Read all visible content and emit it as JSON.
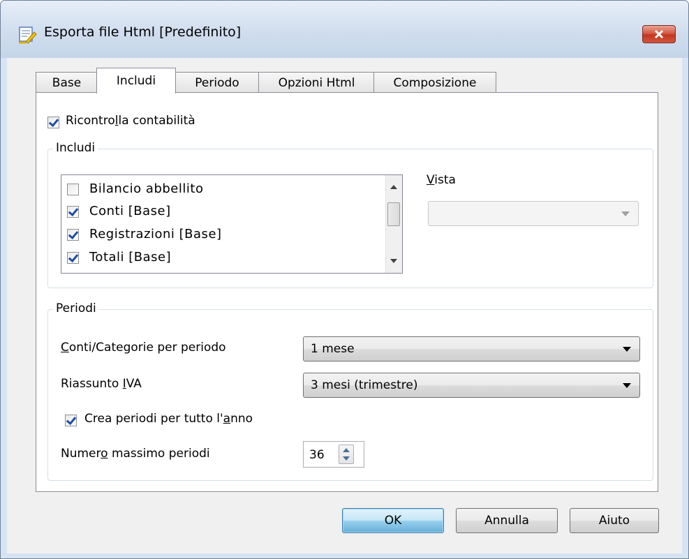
{
  "window": {
    "title": "Esporta file Html [Predefinito]",
    "icon": "document-pencil-icon",
    "close_icon": "close-icon"
  },
  "tabs": [
    {
      "label": "Base",
      "active": false
    },
    {
      "label": "Includi",
      "active": true
    },
    {
      "label": "Periodo",
      "active": false
    },
    {
      "label": "Opzioni Html",
      "active": false
    },
    {
      "label": "Composizione",
      "active": false
    }
  ],
  "recheck": {
    "label_pre": "Ricontro",
    "label_u": "l",
    "label_post": "la contabilità",
    "checked": true
  },
  "includi": {
    "legend": "Includi",
    "items": [
      {
        "label": "Bilancio abbellito",
        "checked": false
      },
      {
        "label": "Conti [Base]",
        "checked": true
      },
      {
        "label": "Registrazioni [Base]",
        "checked": true
      },
      {
        "label": "Totali [Base]",
        "checked": true
      }
    ],
    "vista_label_u": "V",
    "vista_label_rest": "ista",
    "vista_value": ""
  },
  "periodi": {
    "legend": "Periodi",
    "conti_label_u": "C",
    "conti_label_rest": "onti/Categorie per periodo",
    "conti_value": "1 mese",
    "iva_label_pre": "Riassunto ",
    "iva_label_u": "I",
    "iva_label_post": "VA",
    "iva_value": "3 mesi (trimestre)",
    "crea_label_pre": "Crea periodi per tutto l'",
    "crea_label_u": "a",
    "crea_label_post": "nno",
    "crea_checked": true,
    "max_label_pre": "Numer",
    "max_label_u": "o",
    "max_label_post": " massimo periodi",
    "max_value": "36"
  },
  "buttons": {
    "ok": "OK",
    "cancel": "Annulla",
    "help": "Aiuto"
  },
  "colors": {
    "title_bar": "#cfdced",
    "close_button": "#c2371f",
    "default_button": "#98d1ef"
  }
}
